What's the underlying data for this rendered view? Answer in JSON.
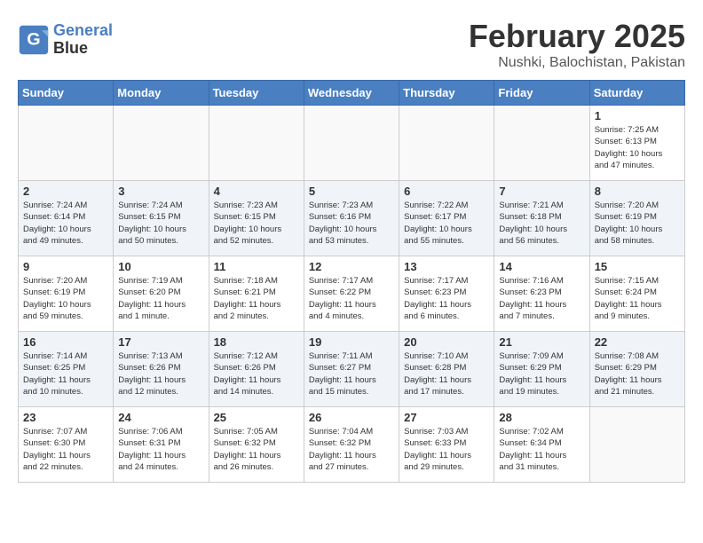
{
  "logo": {
    "line1": "General",
    "line2": "Blue"
  },
  "title": "February 2025",
  "subtitle": "Nushki, Balochistan, Pakistan",
  "weekdays": [
    "Sunday",
    "Monday",
    "Tuesday",
    "Wednesday",
    "Thursday",
    "Friday",
    "Saturday"
  ],
  "weeks": [
    [
      {
        "day": "",
        "info": ""
      },
      {
        "day": "",
        "info": ""
      },
      {
        "day": "",
        "info": ""
      },
      {
        "day": "",
        "info": ""
      },
      {
        "day": "",
        "info": ""
      },
      {
        "day": "",
        "info": ""
      },
      {
        "day": "1",
        "info": "Sunrise: 7:25 AM\nSunset: 6:13 PM\nDaylight: 10 hours\nand 47 minutes."
      }
    ],
    [
      {
        "day": "2",
        "info": "Sunrise: 7:24 AM\nSunset: 6:14 PM\nDaylight: 10 hours\nand 49 minutes."
      },
      {
        "day": "3",
        "info": "Sunrise: 7:24 AM\nSunset: 6:15 PM\nDaylight: 10 hours\nand 50 minutes."
      },
      {
        "day": "4",
        "info": "Sunrise: 7:23 AM\nSunset: 6:15 PM\nDaylight: 10 hours\nand 52 minutes."
      },
      {
        "day": "5",
        "info": "Sunrise: 7:23 AM\nSunset: 6:16 PM\nDaylight: 10 hours\nand 53 minutes."
      },
      {
        "day": "6",
        "info": "Sunrise: 7:22 AM\nSunset: 6:17 PM\nDaylight: 10 hours\nand 55 minutes."
      },
      {
        "day": "7",
        "info": "Sunrise: 7:21 AM\nSunset: 6:18 PM\nDaylight: 10 hours\nand 56 minutes."
      },
      {
        "day": "8",
        "info": "Sunrise: 7:20 AM\nSunset: 6:19 PM\nDaylight: 10 hours\nand 58 minutes."
      }
    ],
    [
      {
        "day": "9",
        "info": "Sunrise: 7:20 AM\nSunset: 6:19 PM\nDaylight: 10 hours\nand 59 minutes."
      },
      {
        "day": "10",
        "info": "Sunrise: 7:19 AM\nSunset: 6:20 PM\nDaylight: 11 hours\nand 1 minute."
      },
      {
        "day": "11",
        "info": "Sunrise: 7:18 AM\nSunset: 6:21 PM\nDaylight: 11 hours\nand 2 minutes."
      },
      {
        "day": "12",
        "info": "Sunrise: 7:17 AM\nSunset: 6:22 PM\nDaylight: 11 hours\nand 4 minutes."
      },
      {
        "day": "13",
        "info": "Sunrise: 7:17 AM\nSunset: 6:23 PM\nDaylight: 11 hours\nand 6 minutes."
      },
      {
        "day": "14",
        "info": "Sunrise: 7:16 AM\nSunset: 6:23 PM\nDaylight: 11 hours\nand 7 minutes."
      },
      {
        "day": "15",
        "info": "Sunrise: 7:15 AM\nSunset: 6:24 PM\nDaylight: 11 hours\nand 9 minutes."
      }
    ],
    [
      {
        "day": "16",
        "info": "Sunrise: 7:14 AM\nSunset: 6:25 PM\nDaylight: 11 hours\nand 10 minutes."
      },
      {
        "day": "17",
        "info": "Sunrise: 7:13 AM\nSunset: 6:26 PM\nDaylight: 11 hours\nand 12 minutes."
      },
      {
        "day": "18",
        "info": "Sunrise: 7:12 AM\nSunset: 6:26 PM\nDaylight: 11 hours\nand 14 minutes."
      },
      {
        "day": "19",
        "info": "Sunrise: 7:11 AM\nSunset: 6:27 PM\nDaylight: 11 hours\nand 15 minutes."
      },
      {
        "day": "20",
        "info": "Sunrise: 7:10 AM\nSunset: 6:28 PM\nDaylight: 11 hours\nand 17 minutes."
      },
      {
        "day": "21",
        "info": "Sunrise: 7:09 AM\nSunset: 6:29 PM\nDaylight: 11 hours\nand 19 minutes."
      },
      {
        "day": "22",
        "info": "Sunrise: 7:08 AM\nSunset: 6:29 PM\nDaylight: 11 hours\nand 21 minutes."
      }
    ],
    [
      {
        "day": "23",
        "info": "Sunrise: 7:07 AM\nSunset: 6:30 PM\nDaylight: 11 hours\nand 22 minutes."
      },
      {
        "day": "24",
        "info": "Sunrise: 7:06 AM\nSunset: 6:31 PM\nDaylight: 11 hours\nand 24 minutes."
      },
      {
        "day": "25",
        "info": "Sunrise: 7:05 AM\nSunset: 6:32 PM\nDaylight: 11 hours\nand 26 minutes."
      },
      {
        "day": "26",
        "info": "Sunrise: 7:04 AM\nSunset: 6:32 PM\nDaylight: 11 hours\nand 27 minutes."
      },
      {
        "day": "27",
        "info": "Sunrise: 7:03 AM\nSunset: 6:33 PM\nDaylight: 11 hours\nand 29 minutes."
      },
      {
        "day": "28",
        "info": "Sunrise: 7:02 AM\nSunset: 6:34 PM\nDaylight: 11 hours\nand 31 minutes."
      },
      {
        "day": "",
        "info": ""
      }
    ]
  ]
}
